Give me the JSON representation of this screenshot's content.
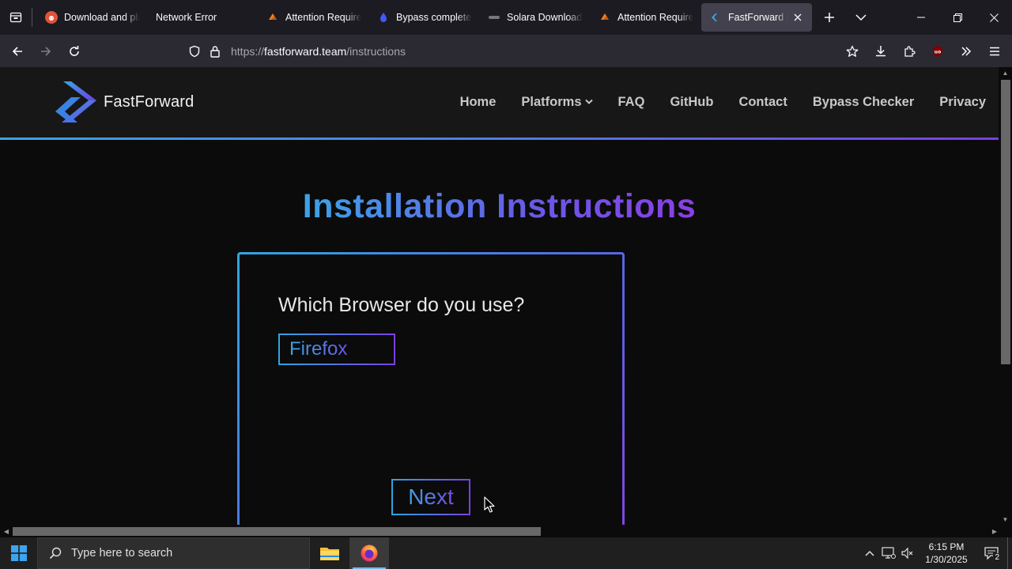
{
  "browser": {
    "tabs": [
      {
        "title": "Download and play",
        "favicon_color": "#e0533a",
        "favicon": "reddit-icon"
      },
      {
        "title": "Network Error",
        "favicon_color": "",
        "favicon": "none"
      },
      {
        "title": "Attention Required!",
        "favicon_color": "#f38020",
        "favicon": "cloudflare-icon"
      },
      {
        "title": "Bypass complete | ",
        "favicon_color": "#3d5afe",
        "favicon": "droplet-icon"
      },
      {
        "title": "Solara Download - ",
        "favicon_color": "#777777",
        "favicon": "solara-icon"
      },
      {
        "title": "Attention Required!",
        "favicon_color": "#f38020",
        "favicon": "cloudflare-icon"
      },
      {
        "title": "FastForward | Instructions",
        "favicon_color": "#3ba4e6",
        "favicon": "fastforward-icon",
        "active": true
      }
    ],
    "url": {
      "scheme": "https://",
      "host": "fastforward.team",
      "path": "/instructions"
    },
    "extension_badge": "uo"
  },
  "site": {
    "brand": "FastForward",
    "nav": [
      "Home",
      "Platforms",
      "FAQ",
      "GitHub",
      "Contact",
      "Bypass Checker",
      "Privacy"
    ],
    "heading": "Installation Instructions",
    "question": "Which Browser do you use?",
    "choice": "Firefox",
    "next_label": "Next",
    "colors": {
      "gradient_start": "#3ba4e6",
      "gradient_end": "#8a3fe4",
      "page_bg": "#0b0b0b"
    }
  },
  "taskbar": {
    "search_placeholder": "Type here to search",
    "time": "6:15 PM",
    "date": "1/30/2025",
    "notification_count": "2"
  }
}
